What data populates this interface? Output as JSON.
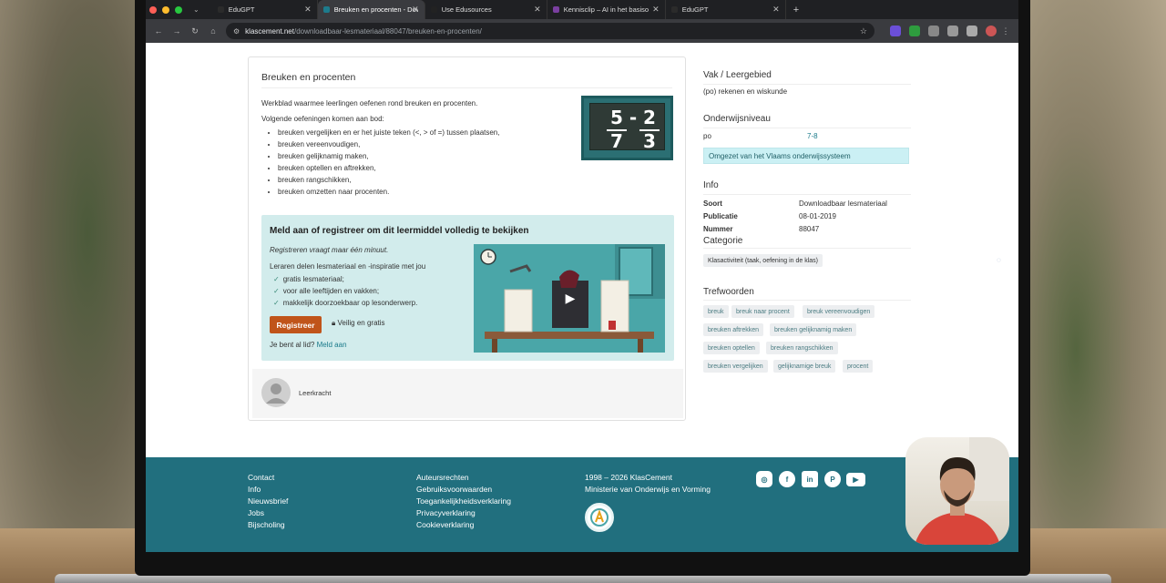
{
  "browser": {
    "tabs": [
      {
        "label": "EduGPT",
        "active": false
      },
      {
        "label": "Breuken en procenten - Dow",
        "active": true
      },
      {
        "label": "Use Edusources",
        "active": false
      },
      {
        "label": "Kennisclip – AI in het basisо",
        "active": false
      },
      {
        "label": "EduGPT",
        "active": false
      }
    ],
    "url_domain": "klascement.net",
    "url_path": "/downloadbaar-lesmateriaal/88047/breuken-en-procenten/"
  },
  "resource": {
    "title": "Breuken en procenten",
    "description": "Werkblad waarmee leerlingen oefenen rond breuken en procenten.",
    "intro": "Volgende oefeningen komen aan bod:",
    "exercises": [
      "breuken vergelijken en er het juiste teken (<, > of =) tussen plaatsen,",
      "breuken vereenvoudigen,",
      "breuken gelijknamig maken,",
      "breuken optellen en aftrekken,",
      "breuken rangschikken,",
      "breuken omzetten naar procenten."
    ],
    "thumb": {
      "n1": "5",
      "op": "-",
      "n2": "2",
      "d1": "7",
      "d2": "3"
    }
  },
  "register": {
    "heading": "Meld aan of registreer om dit leermiddel volledig te bekijken",
    "subtitle": "Registreren vraagt maar één minuut.",
    "lead": "Leraren delen lesmateriaal en -inspiratie met jou",
    "benefits": [
      "gratis lesmateriaal;",
      "voor alle leeftijden en vakken;",
      "makkelijk doorzoekbaar op lesonderwerp."
    ],
    "button": "Registreer",
    "safe": "Veilig en gratis",
    "member_q": "Je bent al lid?",
    "member_link": "Meld aan"
  },
  "author": {
    "role": "Leerkracht"
  },
  "sidebar": {
    "vak_title": "Vak / Leergebied",
    "vak_value": "(po) rekenen en wiskunde",
    "niveau_title": "Onderwijsniveau",
    "niveau_key": "po",
    "niveau_value": "7-8",
    "notice": "Omgezet van het Vlaams onderwijssysteem",
    "info_title": "Info",
    "info": [
      {
        "key": "Soort",
        "value": "Downloadbaar lesmateriaal"
      },
      {
        "key": "Publicatie",
        "value": "08-01-2019"
      },
      {
        "key": "Nummer",
        "value": "88047"
      }
    ],
    "categorie_title": "Categorie",
    "categorie": "Klasactiviteit (taak, oefening in de klas)",
    "trefwoorden_title": "Trefwoorden",
    "tags": [
      "breuk",
      "breuk naar procent",
      "breuk vereenvoudigen",
      "breuken aftrekken",
      "breuken gelijknamig maken",
      "breuken optellen",
      "breuken rangschikken",
      "breuken vergelijken",
      "gelijknamige breuk",
      "procent"
    ]
  },
  "footer": {
    "col1": [
      "Contact",
      "Info",
      "Nieuwsbrief",
      "Jobs",
      "Bijscholing"
    ],
    "col2": [
      "Auteursrechten",
      "Gebruiksvoorwaarden",
      "Toegankelijkheidsverklaring",
      "Privacyverklaring",
      "Cookieverklaring"
    ],
    "copyright": "1998 – 2026 KlasCement",
    "ministry": "Ministerie van Onderwijs en Vorming",
    "social_icons": [
      "instagram-icon",
      "facebook-icon",
      "linkedin-icon",
      "pinterest-icon",
      "youtube-icon"
    ]
  },
  "colors": {
    "accent": "#216f7e",
    "button": "#c0541a",
    "panel": "#d2ecec"
  }
}
